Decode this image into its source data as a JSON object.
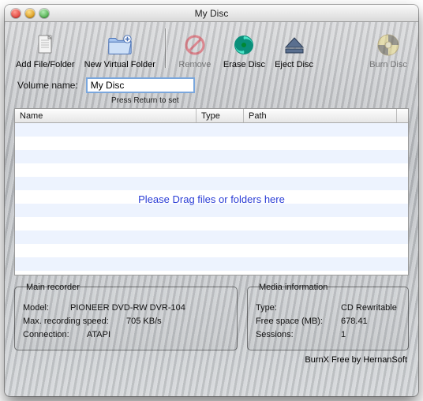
{
  "window": {
    "title": "My Disc"
  },
  "toolbar": {
    "addFileFolder": "Add File/Folder",
    "newVirtualFolder": "New Virtual Folder",
    "remove": "Remove",
    "eraseDisc": "Erase Disc",
    "ejectDisc": "Eject Disc",
    "burnDisc": "Burn Disc"
  },
  "volume": {
    "label": "Volume name:",
    "value": "My Disc",
    "hint": "Press Return to set"
  },
  "table": {
    "columns": {
      "name": "Name",
      "type": "Type",
      "path": "Path"
    },
    "emptyMessage": "Please Drag files or folders here"
  },
  "recorder": {
    "legend": "Main recorder",
    "modelLabel": "Model:",
    "model": "PIONEER DVD-RW DVR-104",
    "speedLabel": "Max. recording speed:",
    "speed": "705 KB/s",
    "connLabel": "Connection:",
    "conn": "ATAPI"
  },
  "media": {
    "legend": "Media information",
    "typeLabel": "Type:",
    "type": "CD Rewritable",
    "freeLabel": "Free space (MB):",
    "free": "678.41",
    "sessionsLabel": "Sessions:",
    "sessions": "1"
  },
  "credit": "BurnX Free by HernanSoft"
}
